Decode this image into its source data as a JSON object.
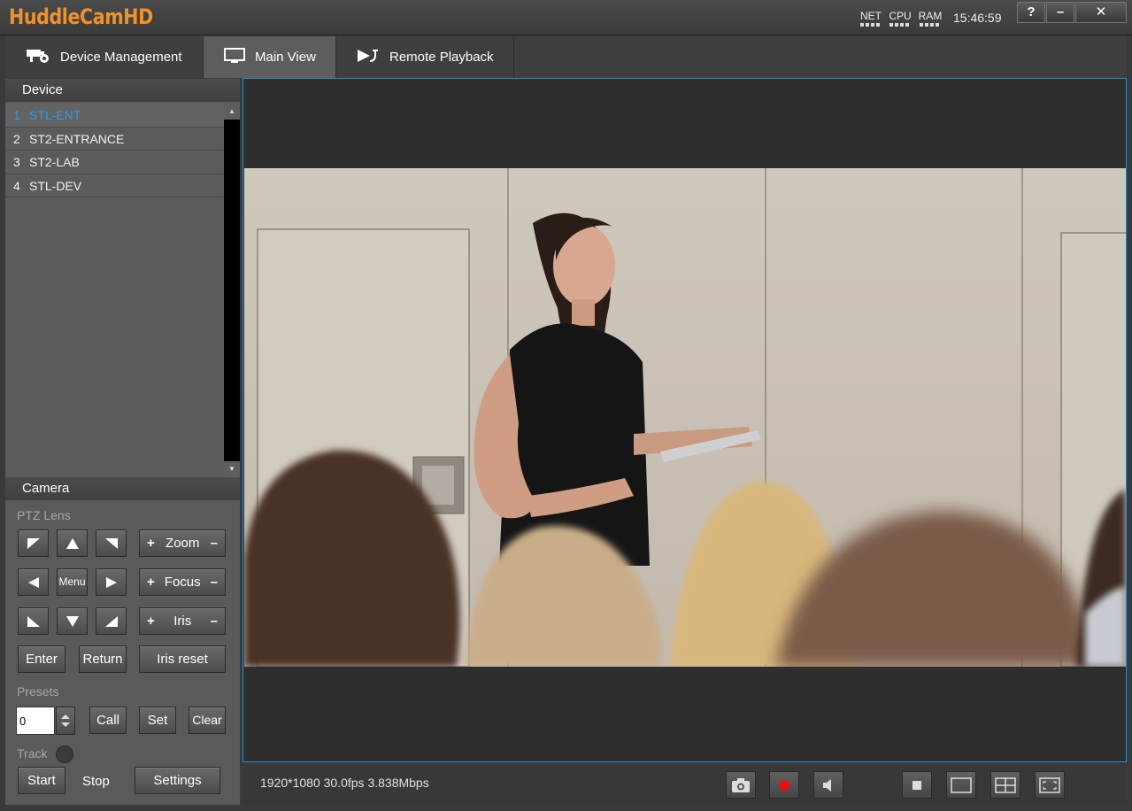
{
  "app": {
    "title": "HuddleCamHD",
    "meters": {
      "net": "NET",
      "cpu": "CPU",
      "ram": "RAM"
    },
    "clock": "15:46:59",
    "window_buttons": {
      "help": "?",
      "minimize": "–",
      "close": "✕"
    }
  },
  "tabs": [
    {
      "label": "Device Management",
      "icon": "camera-cog-icon"
    },
    {
      "label": "Main View",
      "icon": "monitor-icon",
      "active": true
    },
    {
      "label": "Remote Playback",
      "icon": "playback-icon"
    }
  ],
  "device_panel": {
    "header": "Device",
    "items": [
      {
        "num": "1",
        "name": "STL-ENT",
        "selected": true
      },
      {
        "num": "2",
        "name": "ST2-ENTRANCE"
      },
      {
        "num": "3",
        "name": "ST2-LAB"
      },
      {
        "num": "4",
        "name": "STL-DEV"
      }
    ]
  },
  "camera_panel": {
    "header": "Camera",
    "ptz_label": "PTZ Lens",
    "menu": "Menu",
    "zoom": "Zoom",
    "focus": "Focus",
    "iris": "Iris",
    "plus": "+",
    "minus": "–",
    "enter": "Enter",
    "return": "Return",
    "iris_reset": "Iris reset",
    "presets_label": "Presets",
    "preset_value": "0",
    "call": "Call",
    "set": "Set",
    "clear": "Clear",
    "track_label": "Track",
    "start": "Start",
    "stop": "Stop",
    "settings": "Settings"
  },
  "status": {
    "stream_info": "1920*1080 30.0fps 3.838Mbps"
  },
  "colors": {
    "logo": "#f0922b",
    "selected_device": "#2e9be0",
    "view_border": "#2a8fd0",
    "record": "#e81010"
  }
}
